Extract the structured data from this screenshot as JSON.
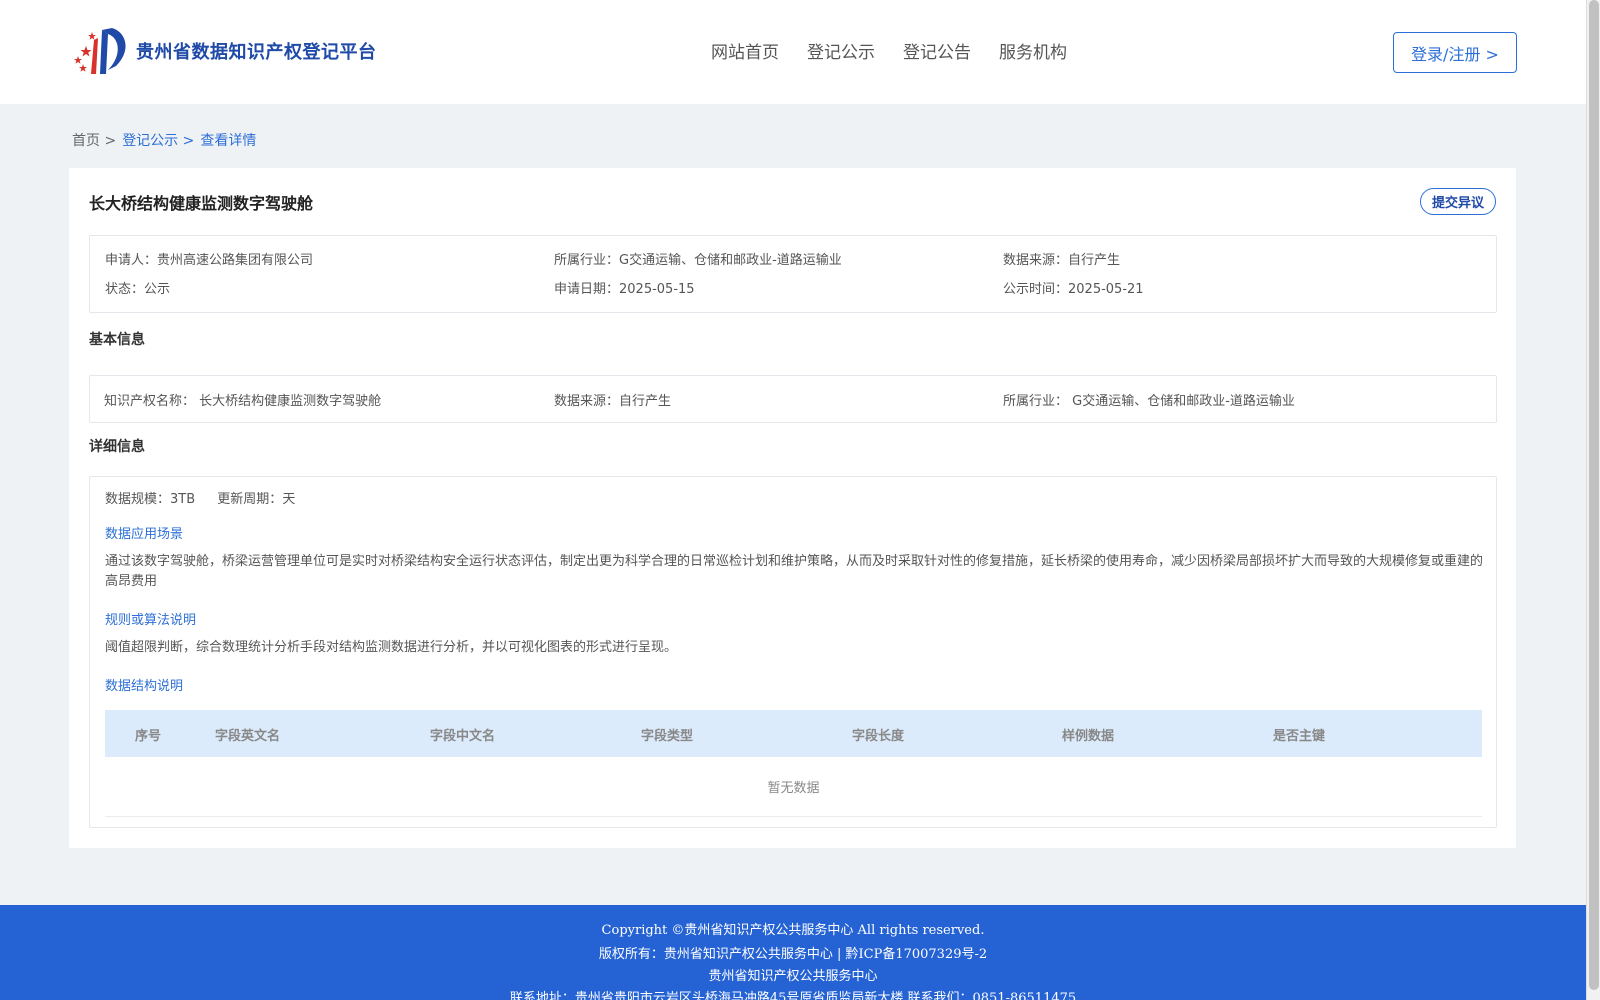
{
  "header": {
    "logo_text": "贵州省数据知识产权登记平台",
    "nav": [
      "网站首页",
      "登记公示",
      "登记公告",
      "服务机构"
    ],
    "login_label": "登录/注册 >"
  },
  "breadcrumb": {
    "home": "首页 >",
    "list": "登记公示 >",
    "current": "查看详情"
  },
  "detail": {
    "title": "长大桥结构健康监测数字驾驶舱",
    "objection_label": "提交异议",
    "summary": {
      "applicant_label": "申请人：",
      "applicant": "贵州高速公路集团有限公司",
      "industry_label": "所属行业：",
      "industry": "G交通运输、仓储和邮政业-道路运输业",
      "source_label": "数据来源：",
      "source": "自行产生",
      "status_label": "状态：",
      "status": "公示",
      "apply_date_label": "申请日期：",
      "apply_date": "2025-05-15",
      "publish_date_label": "公示时间：",
      "publish_date": "2025-05-21"
    },
    "basic": {
      "heading": "基本信息",
      "ip_name_label": "知识产权名称：",
      "ip_name": "长大桥结构健康监测数字驾驶舱",
      "source_label": "数据来源：",
      "source": "自行产生",
      "industry_label": "所属行业：",
      "industry": "G交通运输、仓储和邮政业-道路运输业"
    },
    "info": {
      "heading": "详细信息",
      "scale_label": "数据规模：",
      "scale": "3TB",
      "cycle_label": "更新周期：",
      "cycle": "天",
      "scenario_heading": "数据应用场景",
      "scenario_text": "通过该数字驾驶舱，桥梁运营管理单位可是实时对桥梁结构安全运行状态评估，制定出更为科学合理的日常巡检计划和维护策略，从而及时采取针对性的修复措施，延长桥梁的使用寿命，减少因桥梁局部损坏扩大而导致的大规模修复或重建的高昂费用",
      "algorithm_heading": "规则或算法说明",
      "algorithm_text": "阈值超限判断，综合数理统计分析手段对结构监测数据进行分析，并以可视化图表的形式进行呈现。",
      "structure_heading": "数据结构说明",
      "table_headers": [
        "序号",
        "字段英文名",
        "字段中文名",
        "字段类型",
        "字段长度",
        "样例数据",
        "是否主键"
      ],
      "table_empty": "暂无数据"
    }
  },
  "footer": {
    "copyright": "Copyright ©贵州省知识产权公共服务中心 All rights reserved.",
    "owner": "版权所有：贵州省知识产权公共服务中心 | 黔ICP备17007329号-2",
    "org": "贵州省知识产权公共服务中心",
    "address": "联系地址：贵州省贵阳市云岩区头桥海马冲路45号原省质监局新大楼 联系我们：0851-86511475"
  }
}
